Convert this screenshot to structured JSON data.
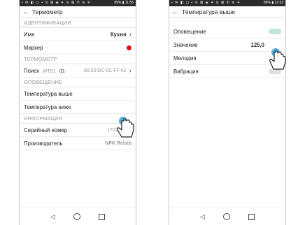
{
  "phone1": {
    "statusbar": {
      "left": "▪ ✉ ◧ ◻ ▪ ⊙ ⊠ ◈ ✦ ⊙ ⊠ ✆ ≋ ✈",
      "right": "89% ▮ 11:55"
    },
    "title": "Термометр",
    "sections": {
      "ident": "ИДЕНТИФИКАЦИЯ",
      "thermo": "ТЕРМОМЕТР",
      "alert": "ОПОВЕЩЕНИЕ",
      "info": "ИНФОРМАЦИЯ"
    },
    "rows": {
      "name_label": "Имя",
      "name_value": "Кухня",
      "marker_label": "Маркер",
      "search_label": "Поиск",
      "search_model": "WT51",
      "search_id_label": "ID:",
      "search_id": "80:30:DC:0C:FF:62",
      "temp_high": "Температура выше",
      "temp_low": "Температура ниже",
      "serial_label": "Серийный номер",
      "serial_value": "170200108",
      "maker_label": "Производитель",
      "maker_value": "NPK Relsib"
    },
    "colors": {
      "accent": "#19a974",
      "marker": "#e0111b"
    }
  },
  "phone2": {
    "statusbar": {
      "left": "▪ ✉ ◧ ◻ ▪ ⊙ ⊠ ◈ ✦ ⊙ ⊠ ✆ ≋ ✈",
      "right": "86% ▮ 12:33"
    },
    "title": "Температура выше",
    "rows": {
      "alert_label": "Оповещение",
      "value_label": "Значение",
      "value_value": "125,0",
      "melody_label": "Мелодия",
      "vibration_label": "Вибрация"
    },
    "toggles": {
      "alert": true,
      "vibration": false
    }
  },
  "icons": [
    "back-arrow-icon",
    "chevron-right-icon",
    "pointing-hand-icon",
    "nav-back-icon",
    "nav-home-icon",
    "nav-recents-icon"
  ]
}
